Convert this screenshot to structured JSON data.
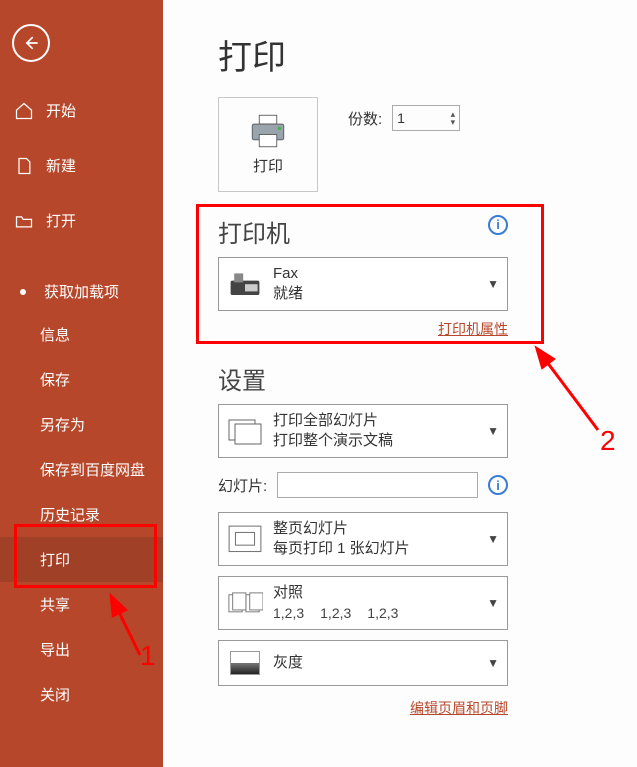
{
  "sidebar": {
    "items": [
      {
        "label": "开始"
      },
      {
        "label": "新建"
      },
      {
        "label": "打开"
      },
      {
        "label": "获取加载项"
      },
      {
        "label": "信息"
      },
      {
        "label": "保存"
      },
      {
        "label": "另存为"
      },
      {
        "label": "保存到百度网盘"
      },
      {
        "label": "历史记录"
      },
      {
        "label": "打印"
      },
      {
        "label": "共享"
      },
      {
        "label": "导出"
      },
      {
        "label": "关闭"
      }
    ]
  },
  "page": {
    "title": "打印",
    "print_button": "打印",
    "copies_label": "份数:",
    "copies_value": "1"
  },
  "printer": {
    "section_title": "打印机",
    "name": "Fax",
    "status": "就绪",
    "properties_link": "打印机属性"
  },
  "settings": {
    "section_title": "设置",
    "scope": {
      "line1": "打印全部幻灯片",
      "line2": "打印整个演示文稿"
    },
    "slides_label": "幻灯片:",
    "slides_value": "",
    "layout": {
      "line1": "整页幻灯片",
      "line2": "每页打印 1 张幻灯片"
    },
    "collate": {
      "line1": "对照",
      "nums": [
        "1,2,3",
        "1,2,3",
        "1,2,3"
      ]
    },
    "color": {
      "line1": "灰度"
    },
    "header_footer_link": "编辑页眉和页脚"
  },
  "annotations": {
    "num1": "1",
    "num2": "2"
  }
}
